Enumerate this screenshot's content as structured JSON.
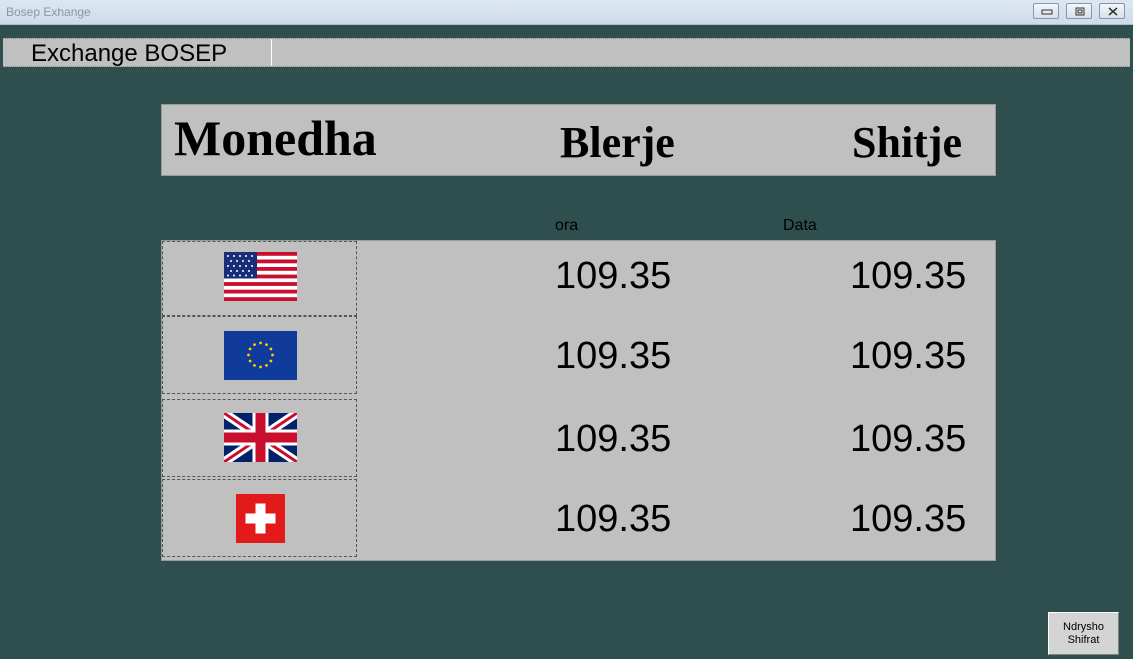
{
  "window": {
    "title": "Bosep Exhange"
  },
  "menu": {
    "label": "Exchange BOSEP"
  },
  "header": {
    "currency": "Monedha",
    "buy": "Blerje",
    "sell": "Shitje"
  },
  "subheader": {
    "time": "ora",
    "date": "Data"
  },
  "rows": [
    {
      "flag": "usa-flag-icon",
      "buy": "109.35",
      "sell": "109.35"
    },
    {
      "flag": "eu-flag-icon",
      "buy": "109.35",
      "sell": "109.35"
    },
    {
      "flag": "uk-flag-icon",
      "buy": "109.35",
      "sell": "109.35"
    },
    {
      "flag": "swiss-flag-icon",
      "buy": "109.35",
      "sell": "109.35"
    }
  ],
  "actions": {
    "change_line1": "Ndrysho",
    "change_line2": "Shifrat"
  }
}
